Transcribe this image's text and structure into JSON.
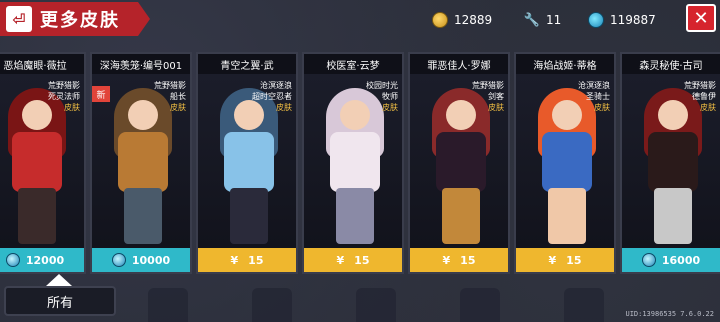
{
  "header": {
    "title": "更多皮肤",
    "back_icon": "back-arrow-icon",
    "close_label": "✕"
  },
  "currencies": {
    "gold": "12889",
    "parts": "11",
    "gems": "119887"
  },
  "cards": [
    {
      "name": "恶焰魔眼·薇拉",
      "line1": "荒野猎影",
      "line2": "死灵法师",
      "skin": "皮肤",
      "price": "12000",
      "price_type": "gem",
      "colors": [
        "#7a1515",
        "#c62c2c",
        "#3a2a2a"
      ]
    },
    {
      "name": "深海羡笼·编号001",
      "line1": "荒野猎影",
      "line2": "船长",
      "skin": "皮肤",
      "price": "10000",
      "price_type": "gem",
      "new": "新",
      "colors": [
        "#6a4a2a",
        "#b97a34",
        "#4a5a6a"
      ]
    },
    {
      "name": "青空之翼·武",
      "line1": "沧溟逐浪",
      "line2": "超时空忍者",
      "skin": "皮肤",
      "price": "15",
      "price_type": "money",
      "colors": [
        "#3a5a7a",
        "#88c2e8",
        "#2a2a3a"
      ]
    },
    {
      "name": "校医室·云梦",
      "line1": "校园时光",
      "line2": "牧师",
      "skin": "皮肤",
      "price": "15",
      "price_type": "money",
      "colors": [
        "#d8c8d8",
        "#f0e6ee",
        "#8a8aa6"
      ]
    },
    {
      "name": "罪恶佳人·罗娜",
      "line1": "荒野猎影",
      "line2": "剑客",
      "skin": "皮肤",
      "price": "15",
      "price_type": "money",
      "colors": [
        "#8a2a2a",
        "#2a1a2a",
        "#c2883a"
      ]
    },
    {
      "name": "海焰战姬·蒂格",
      "line1": "沧溟逐浪",
      "line2": "圣骑士",
      "skin": "皮肤",
      "price": "15",
      "price_type": "money",
      "colors": [
        "#e85a2a",
        "#3a6ac2",
        "#f0c8a8"
      ]
    },
    {
      "name": "森灵秘使·古司",
      "line1": "荒野猎影",
      "line2": "德鲁伊",
      "skin": "皮肤",
      "price": "16000",
      "price_type": "gem",
      "colors": [
        "#7a1a1a",
        "#2a1a1a",
        "#c8c8c8"
      ]
    }
  ],
  "price_symbol": "¥",
  "filter_label": "所有",
  "uid": "UID:13986535 7.6.0.22"
}
